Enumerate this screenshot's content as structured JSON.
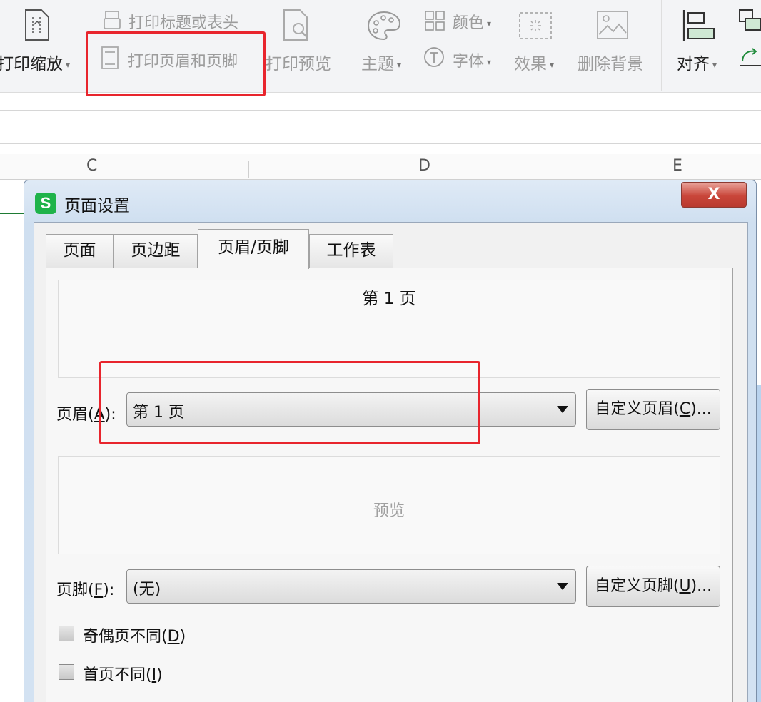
{
  "ribbon": {
    "print_scale": "打印缩放",
    "print_titles": "打印标题或表头",
    "print_header_footer": "打印页眉和页脚",
    "print_preview": "打印预览",
    "theme": "主题",
    "colors": "颜色",
    "fonts": "字体",
    "effects": "效果",
    "remove_background": "删除背景",
    "align": "对齐"
  },
  "columns": [
    "C",
    "D",
    "E"
  ],
  "dialog": {
    "title": "页面设置",
    "close": "X",
    "tabs": [
      "页面",
      "页边距",
      "页眉/页脚",
      "工作表"
    ],
    "header_preview_text": "第 1 页",
    "header_label": "页眉",
    "header_key": "A",
    "header_value": "第 1 页",
    "custom_header_button": "自定义页眉",
    "custom_header_key": "C",
    "footer_preview_text": "预览",
    "footer_label": "页脚",
    "footer_key": "F",
    "footer_value": "(无)",
    "custom_footer_button": "自定义页脚",
    "custom_footer_key": "U",
    "odd_even_label": "奇偶页不同",
    "odd_even_key": "D",
    "first_page_label": "首页不同",
    "first_page_key": "I"
  },
  "highlight_color": "#e8252d",
  "logo_letter": "S"
}
